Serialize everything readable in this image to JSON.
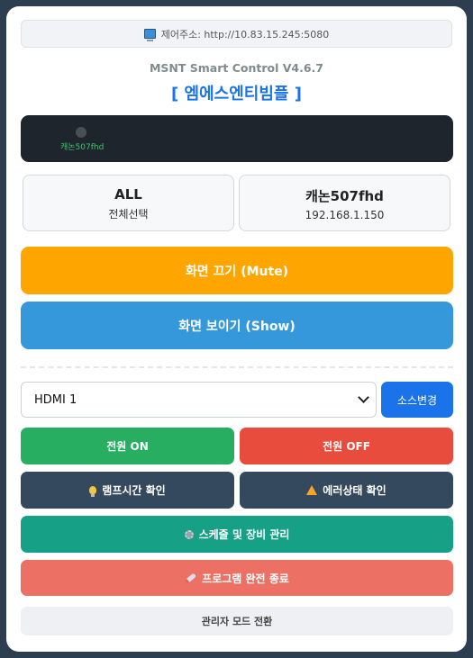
{
  "address": {
    "label": "제어주소: http://10.83.15.245:5080",
    "icon": "computer-icon"
  },
  "version": "MSNT Smart Control V4.6.7",
  "brand": "[ 엠에스엔티빔플 ]",
  "monitor": {
    "device_label": "캐논507fhd",
    "status_color": "#4a4f55"
  },
  "devices": [
    {
      "name": "ALL",
      "sub": "전체선택"
    },
    {
      "name": "캐논507fhd",
      "sub": "192.168.1.150"
    }
  ],
  "actions": {
    "mute_label": "화면 끄기 (Mute)",
    "show_label": "화면 보이기 (Show)"
  },
  "source": {
    "selected": "HDMI 1",
    "change_label": "소스변경"
  },
  "power": {
    "on_label": "전원 ON",
    "off_label": "전원 OFF"
  },
  "checks": {
    "lamp_label": "램프시간 확인",
    "error_label": "에러상태 확인"
  },
  "schedule_label": "스케줄 및 장비 관리",
  "exit_label": "프로그램 완전 종료",
  "admin_label": "관리자 모드 전환",
  "colors": {
    "mute": "#ffa500",
    "show": "#3498db",
    "power_on": "#27ae60",
    "power_off": "#e74c3c",
    "check": "#34495e",
    "schedule": "#16a085",
    "exit": "#ec7063",
    "accent": "#1a73e8"
  }
}
